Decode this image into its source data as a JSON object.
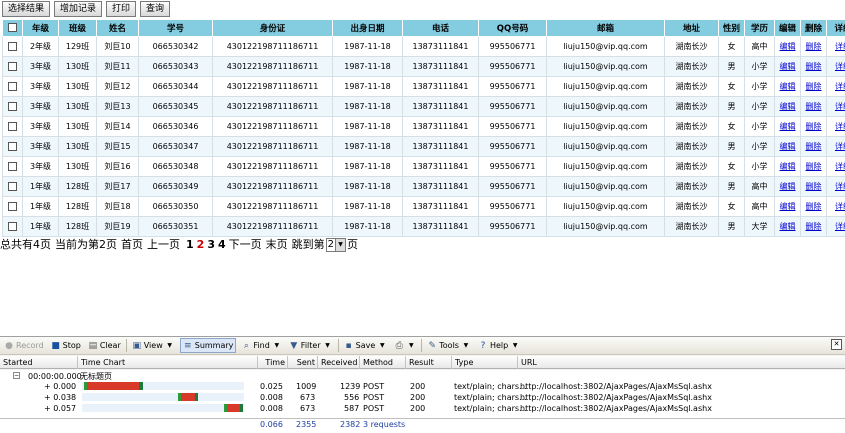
{
  "toolbar": {
    "select_result": "选择结果",
    "add_record": "增加记录",
    "print": "打印",
    "query": "查询"
  },
  "grid": {
    "headers": [
      "",
      "年级",
      "班级",
      "姓名",
      "学号",
      "身份证",
      "出身日期",
      "电话",
      "QQ号码",
      "邮箱",
      "地址",
      "性别",
      "学历",
      "编辑",
      "删除",
      "详细"
    ],
    "rows": [
      [
        "",
        "2年级",
        "129班",
        "刘巨10",
        "066530342",
        "430122198711186711",
        "1987-11-18",
        "13873111841",
        "995506771",
        "liuju150@vip.qq.com",
        "湖南长沙",
        "女",
        "高中",
        "编辑",
        "删除",
        "详细"
      ],
      [
        "",
        "3年级",
        "130班",
        "刘巨11",
        "066530343",
        "430122198711186711",
        "1987-11-18",
        "13873111841",
        "995506771",
        "liuju150@vip.qq.com",
        "湖南长沙",
        "男",
        "小学",
        "编辑",
        "删除",
        "详细"
      ],
      [
        "",
        "3年级",
        "130班",
        "刘巨12",
        "066530344",
        "430122198711186711",
        "1987-11-18",
        "13873111841",
        "995506771",
        "liuju150@vip.qq.com",
        "湖南长沙",
        "女",
        "小学",
        "编辑",
        "删除",
        "详细"
      ],
      [
        "",
        "3年级",
        "130班",
        "刘巨13",
        "066530345",
        "430122198711186711",
        "1987-11-18",
        "13873111841",
        "995506771",
        "liuju150@vip.qq.com",
        "湖南长沙",
        "男",
        "小学",
        "编辑",
        "删除",
        "详细"
      ],
      [
        "",
        "3年级",
        "130班",
        "刘巨14",
        "066530346",
        "430122198711186711",
        "1987-11-18",
        "13873111841",
        "995506771",
        "liuju150@vip.qq.com",
        "湖南长沙",
        "女",
        "小学",
        "编辑",
        "删除",
        "详细"
      ],
      [
        "",
        "3年级",
        "130班",
        "刘巨15",
        "066530347",
        "430122198711186711",
        "1987-11-18",
        "13873111841",
        "995506771",
        "liuju150@vip.qq.com",
        "湖南长沙",
        "男",
        "小学",
        "编辑",
        "删除",
        "详细"
      ],
      [
        "",
        "3年级",
        "130班",
        "刘巨16",
        "066530348",
        "430122198711186711",
        "1987-11-18",
        "13873111841",
        "995506771",
        "liuju150@vip.qq.com",
        "湖南长沙",
        "女",
        "小学",
        "编辑",
        "删除",
        "详细"
      ],
      [
        "",
        "1年级",
        "128班",
        "刘巨17",
        "066530349",
        "430122198711186711",
        "1987-11-18",
        "13873111841",
        "995506771",
        "liuju150@vip.qq.com",
        "湖南长沙",
        "男",
        "高中",
        "编辑",
        "删除",
        "详细"
      ],
      [
        "",
        "1年级",
        "128班",
        "刘巨18",
        "066530350",
        "430122198711186711",
        "1987-11-18",
        "13873111841",
        "995506771",
        "liuju150@vip.qq.com",
        "湖南长沙",
        "女",
        "高中",
        "编辑",
        "删除",
        "详细"
      ],
      [
        "",
        "1年级",
        "128班",
        "刘巨19",
        "066530351",
        "430122198711186711",
        "1987-11-18",
        "13873111841",
        "995506771",
        "liuju150@vip.qq.com",
        "湖南长沙",
        "男",
        "大学",
        "编辑",
        "删除",
        "详细"
      ]
    ]
  },
  "pager": {
    "total": "总共有4页",
    "current": "当前为第2页",
    "first": "首页",
    "prev": "上一页",
    "pages": [
      "1",
      "2",
      "3",
      "4"
    ],
    "current_page": "2",
    "next": "下一页",
    "last": "末页",
    "jump_prefix": "跳到第",
    "jump_value": "2",
    "jump_suffix": "页"
  },
  "httpwatch": {
    "toolbar": {
      "record": "Record",
      "stop": "Stop",
      "clear": "Clear",
      "view": "View",
      "summary": "Summary",
      "find": "Find",
      "filter": "Filter",
      "save": "Save",
      "tools": "Tools",
      "help": "Help"
    },
    "columns": [
      "Started",
      "Time Chart",
      "Time",
      "Sent",
      "Received",
      "Method",
      "Result",
      "Type",
      "URL"
    ],
    "group": {
      "started": "00:00:00.000",
      "title": "无标题页"
    },
    "requests": [
      {
        "started": "+ 0.000",
        "time": "0.025",
        "sent": "1009",
        "received": "1239",
        "method": "POST",
        "result": "200",
        "type": "text/plain; chars...",
        "url": "http://localhost:3802/AjaxPages/AjaxMsSql.ashx"
      },
      {
        "started": "+ 0.038",
        "time": "0.008",
        "sent": "673",
        "received": "556",
        "method": "POST",
        "result": "200",
        "type": "text/plain; chars...",
        "url": "http://localhost:3802/AjaxPages/AjaxMsSql.ashx"
      },
      {
        "started": "+ 0.057",
        "time": "0.008",
        "sent": "673",
        "received": "587",
        "method": "POST",
        "result": "200",
        "type": "text/plain; chars...",
        "url": "http://localhost:3802/AjaxPages/AjaxMsSql.ashx"
      }
    ],
    "summary": {
      "time": "0.066",
      "sent": "2355",
      "received": "2382",
      "count": "3 requests"
    }
  }
}
